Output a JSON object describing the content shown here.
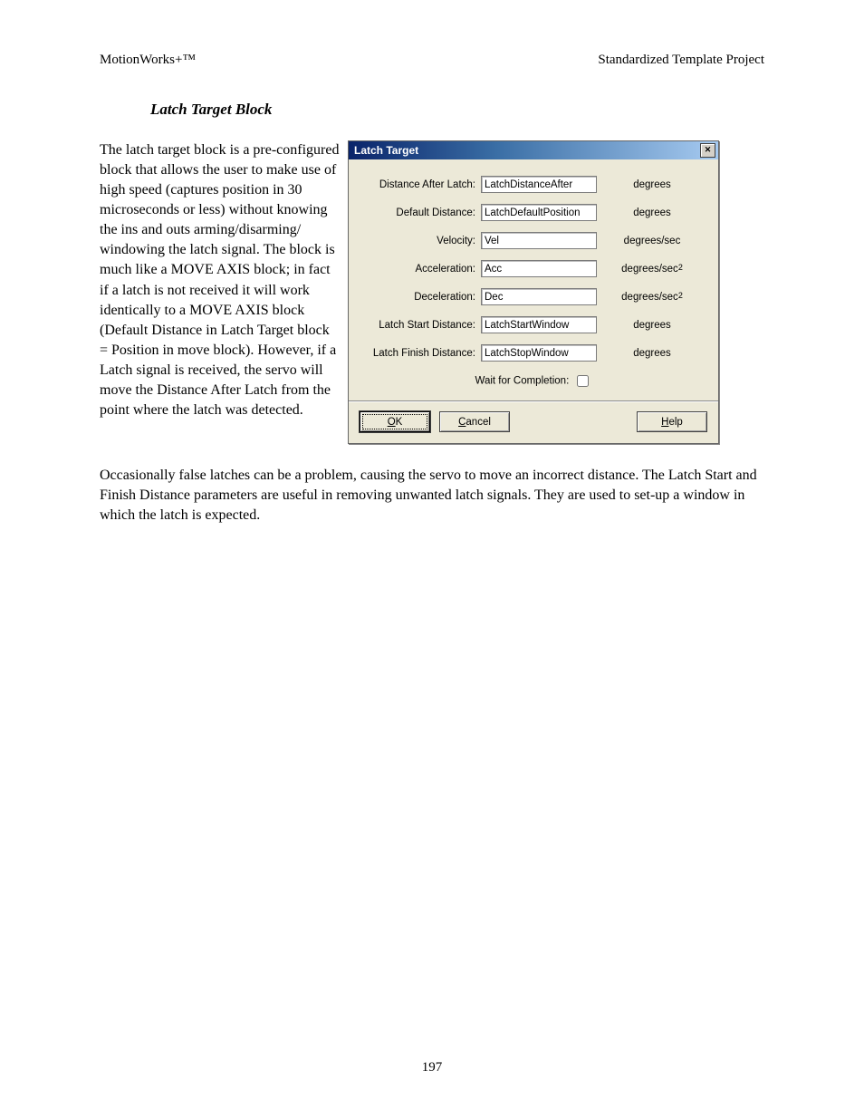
{
  "header": {
    "left": "MotionWorks+™",
    "right": "Standardized Template Project"
  },
  "section_title": "Latch Target Block",
  "paragraph_left": "The latch target block is a pre-configured block that allows the user to make use of high speed (captures position in 30 microseconds or less) without knowing the ins and outs arming/disarming/ windowing the latch signal.  The block is much like a MOVE AXIS block; in fact if a latch is not received it will work identically to a MOVE AXIS block (Default Distance in Latch Target block = Position in move block).  However, if a Latch signal is received, the servo will move the Distance After Latch from the point where the latch was detected.",
  "paragraph_follow": "Occasionally false latches can be a problem, causing the servo to move an incorrect distance.  The Latch Start and Finish Distance parameters are useful in removing unwanted latch signals.  They are used to set-up a window in which the latch is expected.",
  "page_number": "197",
  "dialog": {
    "title": "Latch Target",
    "rows": [
      {
        "label": "Distance After Latch:",
        "value": "LatchDistanceAfter",
        "unit": "degrees"
      },
      {
        "label": "Default Distance:",
        "value": "LatchDefaultPosition",
        "unit": "degrees"
      },
      {
        "label": "Velocity:",
        "value": "Vel",
        "unit": "degrees/sec"
      },
      {
        "label": "Acceleration:",
        "value": "Acc",
        "unit": "degrees/sec2"
      },
      {
        "label": "Deceleration:",
        "value": "Dec",
        "unit": "degrees/sec2"
      },
      {
        "label": "Latch Start Distance:",
        "value": "LatchStartWindow",
        "unit": "degrees"
      },
      {
        "label": "Latch Finish Distance:",
        "value": "LatchStopWindow",
        "unit": "degrees"
      }
    ],
    "wait_label": "Wait for Completion:",
    "buttons": {
      "ok": "OK",
      "cancel": "Cancel",
      "help": "Help"
    }
  }
}
